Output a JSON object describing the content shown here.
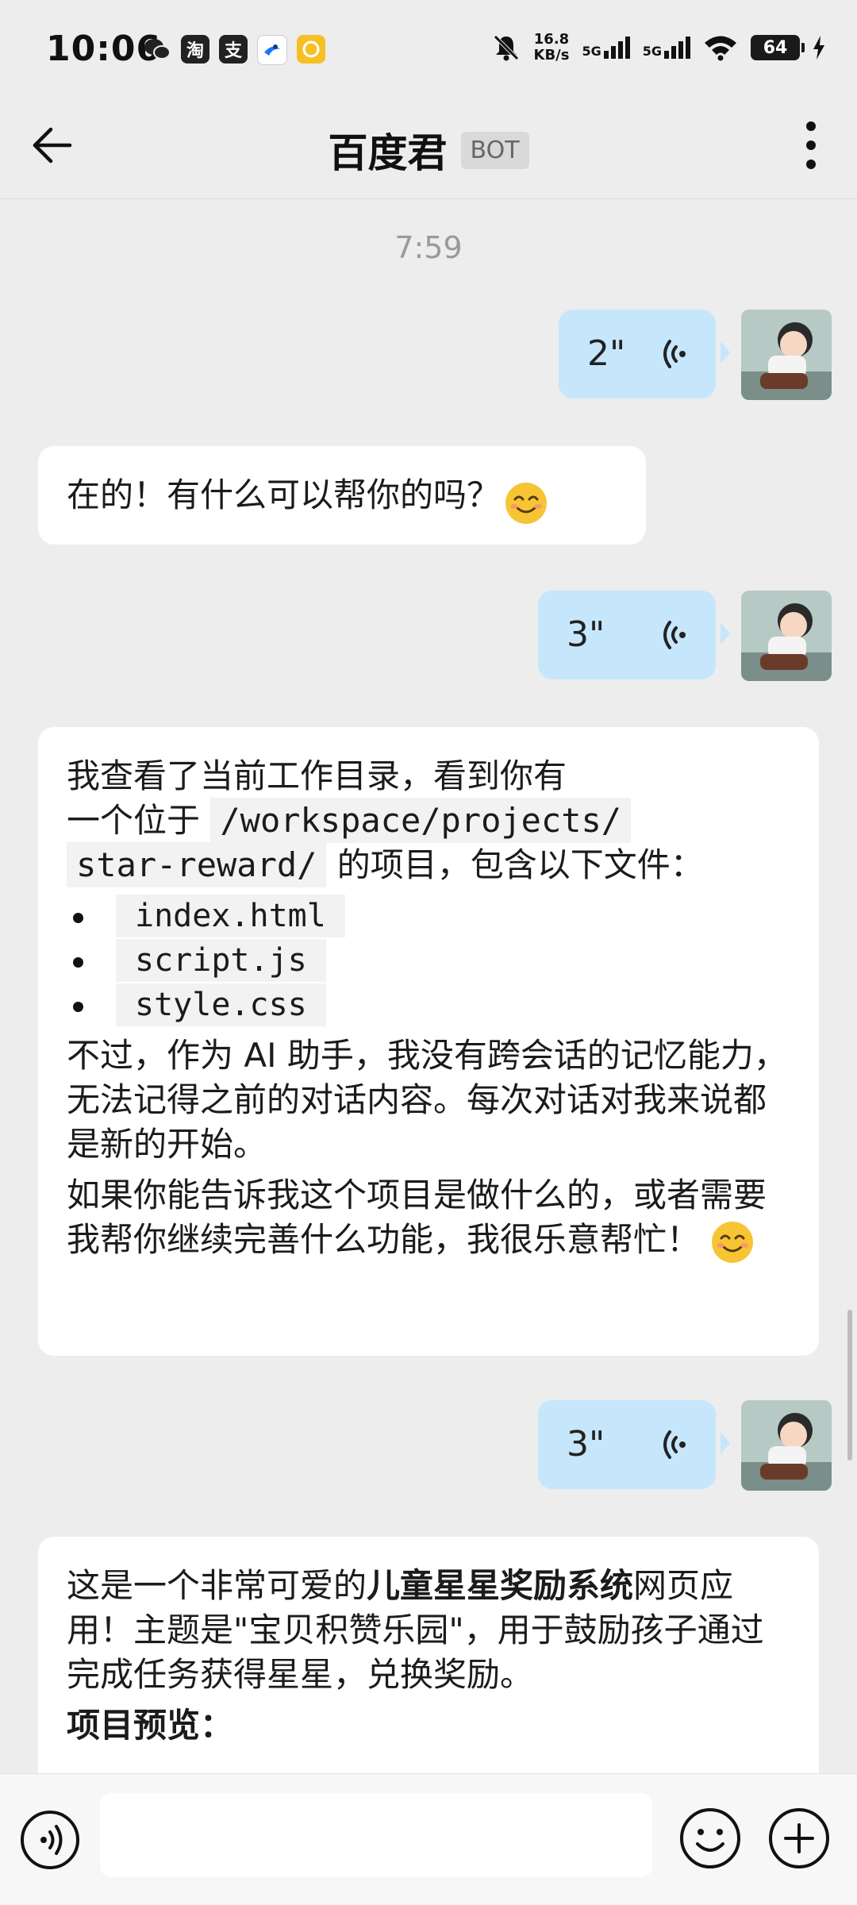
{
  "status_bar": {
    "time": "10:06",
    "app_icons": [
      "wechat-icon",
      "taobao-icon",
      "alipay-icon",
      "app-icon",
      "yellow-app-icon"
    ],
    "app_icon_labels": {
      "taobao": "淘",
      "alipay": "支"
    },
    "net_speed_value": "16.8",
    "net_speed_unit": "KB/s",
    "sim1": "5G",
    "sim2": "5G",
    "battery": "64"
  },
  "header": {
    "title": "百度君",
    "badge": "BOT"
  },
  "chat": {
    "timestamp": "7:59",
    "messages": [
      {
        "type": "voice",
        "from": "user",
        "duration": "2\""
      },
      {
        "type": "text",
        "from": "bot",
        "text": "在的！有什么可以帮你的吗？"
      },
      {
        "type": "voice",
        "from": "user",
        "duration": "3\""
      },
      {
        "type": "rich",
        "from": "bot",
        "p1_a": "我查看了当前工作目录，看到你有",
        "p1_b": "一个位于",
        "path_1": "/workspace/projects/",
        "path_2": "star-reward/",
        "p1_c": "的项目，包含以下文件：",
        "files": [
          "index.html",
          "script.js",
          "style.css"
        ],
        "p2": "不过，作为 AI 助手，我没有跨会话的记忆能力，无法记得之前的对话内容。每次对话对我来说都是新的开始。",
        "p3": "如果你能告诉我这个项目是做什么的，或者需要我帮你继续完善什么功能，我很乐意帮忙！"
      },
      {
        "type": "voice",
        "from": "user",
        "duration": "3\""
      },
      {
        "type": "rich",
        "from": "bot",
        "p1_a": "这是一个非常可爱的",
        "p1_bold": "儿童星星奖励系统",
        "p1_b": "网页应用！主题是\"宝贝积赞乐园\"，用于鼓励孩子通过完成任务获得星星，兑换奖励。",
        "heading": "项目预览："
      }
    ]
  },
  "input_bar": {
    "placeholder": ""
  },
  "colors": {
    "background": "#ededed",
    "user_bubble": "#c6e6fb",
    "bot_bubble": "#ffffff",
    "timestamp": "#9a9a9a"
  }
}
